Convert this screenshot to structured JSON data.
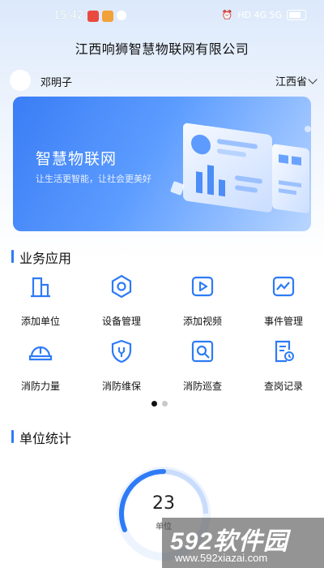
{
  "status_bar": {
    "time": "15:42",
    "right_text": "HD 4G 5G"
  },
  "header": {
    "company": "江西响狮智慧物联网有限公司"
  },
  "user": {
    "name": "邓明子",
    "province": "江西省"
  },
  "banner": {
    "title": "智慧物联网",
    "subtitle": "让生活更智能，让社会更美好"
  },
  "business": {
    "title": "业务应用",
    "items": [
      {
        "label": "添加单位",
        "icon": "building-icon"
      },
      {
        "label": "设备管理",
        "icon": "device-hexagon-icon"
      },
      {
        "label": "添加视频",
        "icon": "video-play-icon"
      },
      {
        "label": "事件管理",
        "icon": "event-chart-icon"
      },
      {
        "label": "消防力量",
        "icon": "helmet-icon"
      },
      {
        "label": "消防维保",
        "icon": "shield-wrench-icon"
      },
      {
        "label": "消防巡查",
        "icon": "inspect-search-icon"
      },
      {
        "label": "查岗记录",
        "icon": "record-clock-icon"
      }
    ],
    "pager": {
      "pages": 2,
      "active": 1
    }
  },
  "stats": {
    "title": "单位统计",
    "count": "23",
    "label": "单位"
  },
  "watermark": {
    "main": "592软件园",
    "sub": "www.592xiazai.com"
  },
  "colors": {
    "accent": "#2e7bf6",
    "banner": "#3a7df5"
  }
}
